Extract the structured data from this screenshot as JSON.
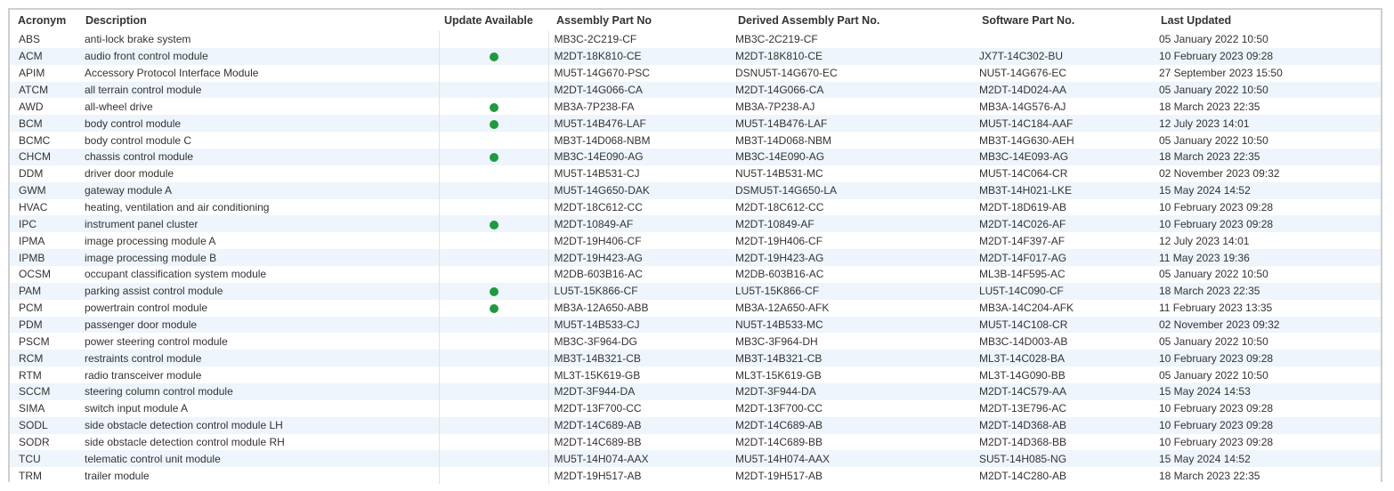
{
  "colors": {
    "stripe": "#eef5fc",
    "update_dot": "#1f9a3f",
    "border": "#cfcfcf"
  },
  "table": {
    "headers": {
      "acronym": "Acronym",
      "description": "Description",
      "update": "Update Available",
      "assembly": "Assembly Part No",
      "derived": "Derived Assembly Part No.",
      "software": "Software Part No.",
      "updated": "Last Updated"
    },
    "rows": [
      {
        "acronym": "ABS",
        "description": "anti-lock brake system",
        "update": false,
        "assembly": "MB3C-2C219-CF",
        "derived": "MB3C-2C219-CF",
        "software": "",
        "updated": "05 January 2022 10:50"
      },
      {
        "acronym": "ACM",
        "description": "audio front control module",
        "update": true,
        "assembly": "M2DT-18K810-CE",
        "derived": "M2DT-18K810-CE",
        "software": "JX7T-14C302-BU",
        "updated": "10 February 2023 09:28"
      },
      {
        "acronym": "APIM",
        "description": "Accessory Protocol Interface Module",
        "update": false,
        "assembly": "MU5T-14G670-PSC",
        "derived": "DSNU5T-14G670-EC",
        "software": "NU5T-14G676-EC",
        "updated": "27 September 2023 15:50"
      },
      {
        "acronym": "ATCM",
        "description": "all terrain control module",
        "update": false,
        "assembly": "M2DT-14G066-CA",
        "derived": "M2DT-14G066-CA",
        "software": "M2DT-14D024-AA",
        "updated": "05 January 2022 10:50"
      },
      {
        "acronym": "AWD",
        "description": "all-wheel drive",
        "update": true,
        "assembly": "MB3A-7P238-FA",
        "derived": "MB3A-7P238-AJ",
        "software": "MB3A-14G576-AJ",
        "updated": "18 March 2023 22:35"
      },
      {
        "acronym": "BCM",
        "description": "body control module",
        "update": true,
        "assembly": "MU5T-14B476-LAF",
        "derived": "MU5T-14B476-LAF",
        "software": "MU5T-14C184-AAF",
        "updated": "12 July 2023 14:01"
      },
      {
        "acronym": "BCMC",
        "description": "body control module C",
        "update": false,
        "assembly": "MB3T-14D068-NBM",
        "derived": "MB3T-14D068-NBM",
        "software": "MB3T-14G630-AEH",
        "updated": "05 January 2022 10:50"
      },
      {
        "acronym": "CHCM",
        "description": "chassis control module",
        "update": true,
        "assembly": "MB3C-14E090-AG",
        "derived": "MB3C-14E090-AG",
        "software": "MB3C-14E093-AG",
        "updated": "18 March 2023 22:35"
      },
      {
        "acronym": "DDM",
        "description": "driver door module",
        "update": false,
        "assembly": "MU5T-14B531-CJ",
        "derived": "NU5T-14B531-MC",
        "software": "MU5T-14C064-CR",
        "updated": "02 November 2023 09:32"
      },
      {
        "acronym": "GWM",
        "description": "gateway module A",
        "update": false,
        "assembly": "MU5T-14G650-DAK",
        "derived": "DSMU5T-14G650-LA",
        "software": "MB3T-14H021-LKE",
        "updated": "15 May 2024 14:52"
      },
      {
        "acronym": "HVAC",
        "description": "heating, ventilation and air conditioning",
        "update": false,
        "assembly": "M2DT-18C612-CC",
        "derived": "M2DT-18C612-CC",
        "software": "M2DT-18D619-AB",
        "updated": "10 February 2023 09:28"
      },
      {
        "acronym": "IPC",
        "description": "instrument panel cluster",
        "update": true,
        "assembly": "M2DT-10849-AF",
        "derived": "M2DT-10849-AF",
        "software": "M2DT-14C026-AF",
        "updated": "10 February 2023 09:28"
      },
      {
        "acronym": "IPMA",
        "description": "image processing module A",
        "update": false,
        "assembly": "M2DT-19H406-CF",
        "derived": "M2DT-19H406-CF",
        "software": "M2DT-14F397-AF",
        "updated": "12 July 2023 14:01"
      },
      {
        "acronym": "IPMB",
        "description": "image processing module B",
        "update": false,
        "assembly": "M2DT-19H423-AG",
        "derived": "M2DT-19H423-AG",
        "software": "M2DT-14F017-AG",
        "updated": "11 May 2023 19:36"
      },
      {
        "acronym": "OCSM",
        "description": "occupant classification system module",
        "update": false,
        "assembly": "M2DB-603B16-AC",
        "derived": "M2DB-603B16-AC",
        "software": "ML3B-14F595-AC",
        "updated": "05 January 2022 10:50"
      },
      {
        "acronym": "PAM",
        "description": "parking assist control module",
        "update": true,
        "assembly": "LU5T-15K866-CF",
        "derived": "LU5T-15K866-CF",
        "software": "LU5T-14C090-CF",
        "updated": "18 March 2023 22:35"
      },
      {
        "acronym": "PCM",
        "description": "powertrain control module",
        "update": true,
        "assembly": "MB3A-12A650-ABB",
        "derived": "MB3A-12A650-AFK",
        "software": "MB3A-14C204-AFK",
        "updated": "11 February 2023 13:35"
      },
      {
        "acronym": "PDM",
        "description": "passenger door module",
        "update": false,
        "assembly": "MU5T-14B533-CJ",
        "derived": "NU5T-14B533-MC",
        "software": "MU5T-14C108-CR",
        "updated": "02 November 2023 09:32"
      },
      {
        "acronym": "PSCM",
        "description": "power steering control module",
        "update": false,
        "assembly": "MB3C-3F964-DG",
        "derived": "MB3C-3F964-DH",
        "software": "MB3C-14D003-AB",
        "updated": "05 January 2022 10:50"
      },
      {
        "acronym": "RCM",
        "description": "restraints control module",
        "update": false,
        "assembly": "MB3T-14B321-CB",
        "derived": "MB3T-14B321-CB",
        "software": "ML3T-14C028-BA",
        "updated": "10 February 2023 09:28"
      },
      {
        "acronym": "RTM",
        "description": "radio transceiver module",
        "update": false,
        "assembly": "ML3T-15K619-GB",
        "derived": "ML3T-15K619-GB",
        "software": "ML3T-14G090-BB",
        "updated": "05 January 2022 10:50"
      },
      {
        "acronym": "SCCM",
        "description": "steering column control module",
        "update": false,
        "assembly": "M2DT-3F944-DA",
        "derived": "M2DT-3F944-DA",
        "software": "M2DT-14C579-AA",
        "updated": "15 May 2024 14:53"
      },
      {
        "acronym": "SIMA",
        "description": "switch input module A",
        "update": false,
        "assembly": "M2DT-13F700-CC",
        "derived": "M2DT-13F700-CC",
        "software": "M2DT-13E796-AC",
        "updated": "10 February 2023 09:28"
      },
      {
        "acronym": "SODL",
        "description": "side obstacle detection control module LH",
        "update": false,
        "assembly": "M2DT-14C689-AB",
        "derived": "M2DT-14C689-AB",
        "software": "M2DT-14D368-AB",
        "updated": "10 February 2023 09:28"
      },
      {
        "acronym": "SODR",
        "description": "side obstacle detection control module RH",
        "update": false,
        "assembly": "M2DT-14C689-BB",
        "derived": "M2DT-14C689-BB",
        "software": "M2DT-14D368-BB",
        "updated": "10 February 2023 09:28"
      },
      {
        "acronym": "TCU",
        "description": "telematic control unit module",
        "update": false,
        "assembly": "MU5T-14H074-AAX",
        "derived": "MU5T-14H074-AAX",
        "software": "SU5T-14H085-NG",
        "updated": "15 May 2024 14:52"
      },
      {
        "acronym": "TRM",
        "description": "trailer module",
        "update": false,
        "assembly": "M2DT-19H517-AB",
        "derived": "M2DT-19H517-AB",
        "software": "M2DT-14C280-AB",
        "updated": "18 March 2023 22:35"
      }
    ]
  }
}
